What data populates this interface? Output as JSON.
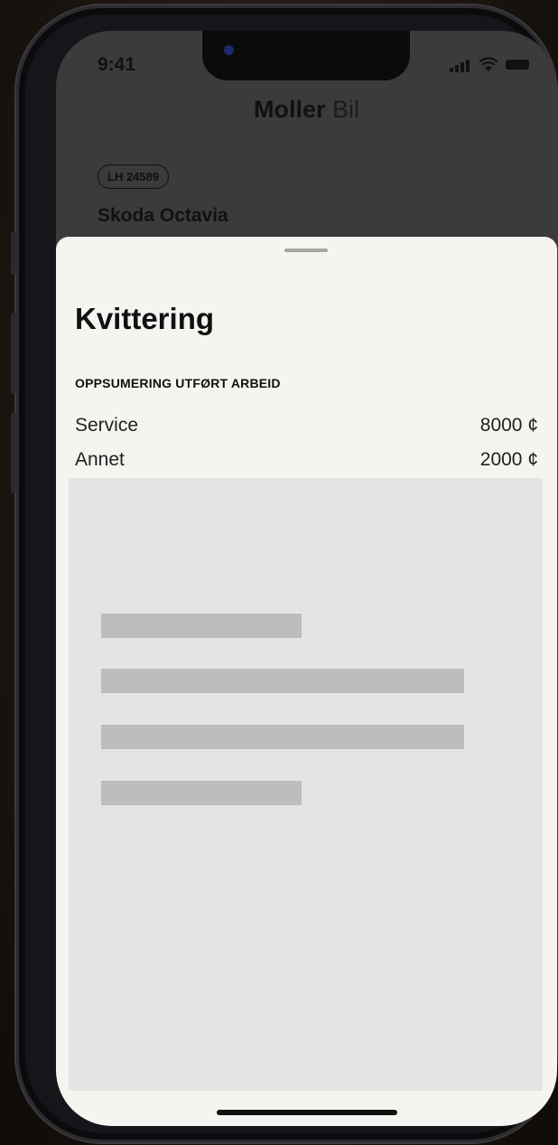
{
  "status_bar": {
    "time": "9:41",
    "icons": [
      "signal-icon",
      "wifi-icon",
      "battery-icon"
    ]
  },
  "header": {
    "brand_bold": "Moller",
    "brand_light": "Bil"
  },
  "vehicle": {
    "plate": "LH 24589",
    "name": "Skoda Octavia"
  },
  "sheet": {
    "title": "Kvittering",
    "section_label": "OPPSUMERING UTFØRT ARBEID",
    "items": [
      {
        "label": "Service",
        "amount": "8000 ¢"
      },
      {
        "label": "Annet",
        "amount": "2000 ¢"
      }
    ]
  },
  "colors": {
    "sheet_background": "#f6f4f0",
    "placeholder_background": "#e4e4e4",
    "skeleton_bar": "#bdbdbd",
    "backdrop_dim": "#3b3b3b"
  }
}
